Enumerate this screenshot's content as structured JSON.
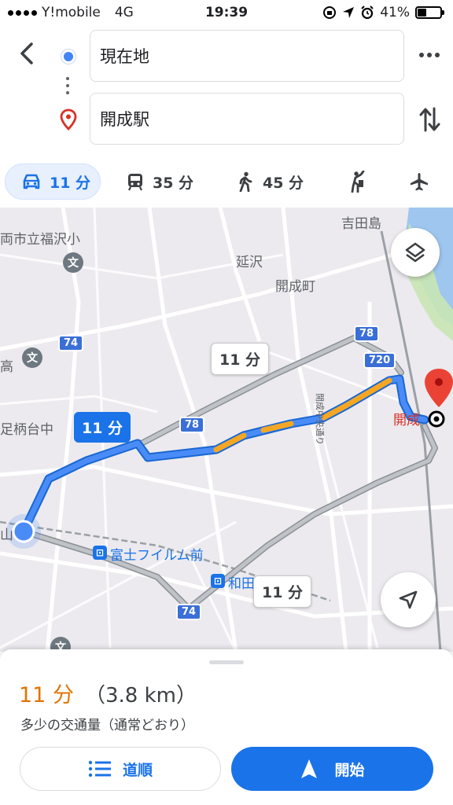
{
  "status_bar": {
    "carrier": "Y!mobile",
    "network": "4G",
    "time": "19:39",
    "battery": "41%",
    "battery_level": 0.41
  },
  "search": {
    "origin": "現在地",
    "destination": "開成駅"
  },
  "modes": [
    {
      "name": "car-icon",
      "label": "11 分",
      "active": true
    },
    {
      "name": "transit-icon",
      "label": "35 分",
      "active": false
    },
    {
      "name": "walk-icon",
      "label": "45 分",
      "active": false
    },
    {
      "name": "rideshare-icon",
      "label": "",
      "active": false
    },
    {
      "name": "flight-icon",
      "label": "",
      "active": false
    }
  ],
  "map": {
    "places": {
      "yoshidajima": "吉田島",
      "fukuzawa": "両市立福沢小",
      "nobesawa": "延沢",
      "kaiseimachi": "開成町",
      "taka": "高",
      "ashigaradai": "足柄台中",
      "kaisei_station": "開成",
      "fujifilm": "富士フイルム前",
      "wada": "和田",
      "yama": "山",
      "chuo_dori": "開成中央通り"
    },
    "roads": {
      "r78a": "78",
      "r78b": "78",
      "r720": "720",
      "r74a": "74",
      "r74b": "74"
    },
    "route_labels": {
      "primary": "11 分",
      "alt1": "11 分",
      "alt2": "11 分"
    },
    "poi_school": "文",
    "station_glyph": "⊡"
  },
  "sheet": {
    "duration": "11 分",
    "distance": "（3.8 km）",
    "traffic": "多少の交通量（通常どおり）",
    "steps_label": "道順",
    "start_label": "開始"
  },
  "colors": {
    "accent": "#1a73e8",
    "duration": "#e37400",
    "route_traffic": "#f5a623"
  }
}
